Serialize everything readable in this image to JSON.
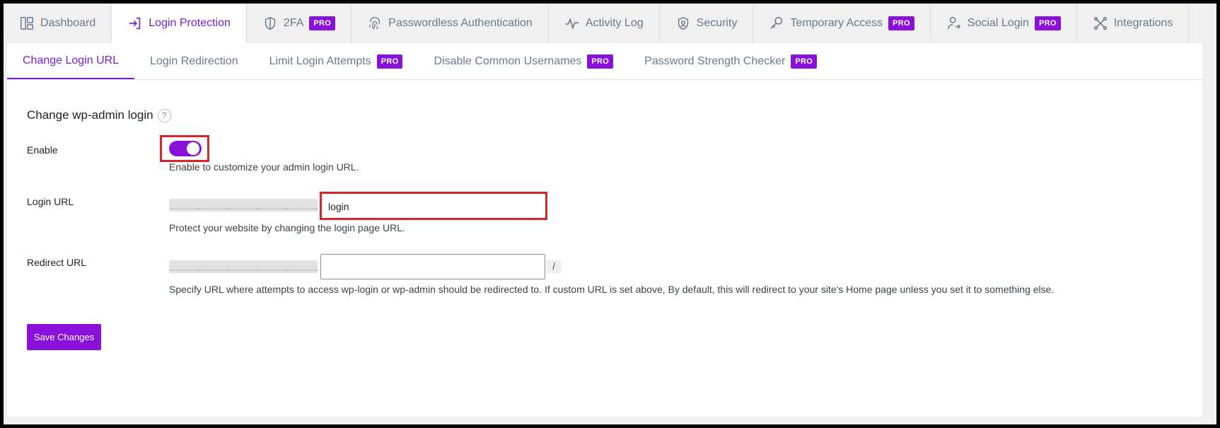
{
  "top_tabs": [
    {
      "label": "Dashboard",
      "icon": "dashboard-icon",
      "pro": false,
      "active": false
    },
    {
      "label": "Login Protection",
      "icon": "login-icon",
      "pro": false,
      "active": true
    },
    {
      "label": "2FA",
      "icon": "shield-icon",
      "pro": true,
      "active": false
    },
    {
      "label": "Passwordless Authentication",
      "icon": "fingerprint-icon",
      "pro": false,
      "active": false
    },
    {
      "label": "Activity Log",
      "icon": "activity-icon",
      "pro": false,
      "active": false
    },
    {
      "label": "Security",
      "icon": "security-shield-icon",
      "pro": false,
      "active": false
    },
    {
      "label": "Temporary Access",
      "icon": "key-icon",
      "pro": true,
      "active": false
    },
    {
      "label": "Social Login",
      "icon": "user-share-icon",
      "pro": true,
      "active": false
    },
    {
      "label": "Integrations",
      "icon": "integrations-icon",
      "pro": false,
      "active": false
    }
  ],
  "pro_badge": "PRO",
  "sub_tabs": [
    {
      "label": "Change Login URL",
      "pro": false,
      "active": true
    },
    {
      "label": "Login Redirection",
      "pro": false,
      "active": false
    },
    {
      "label": "Limit Login Attempts",
      "pro": true,
      "active": false
    },
    {
      "label": "Disable Common Usernames",
      "pro": true,
      "active": false
    },
    {
      "label": "Password Strength Checker",
      "pro": true,
      "active": false
    }
  ],
  "section": {
    "title": "Change wp-admin login",
    "help": "?"
  },
  "enable": {
    "label": "Enable",
    "checked": true,
    "description": "Enable to customize your admin login URL."
  },
  "login_url": {
    "label": "Login URL",
    "value": "login",
    "description": "Protect your website by changing the login page URL."
  },
  "redirect_url": {
    "label": "Redirect URL",
    "value": "",
    "suffix": "/",
    "description": "Specify URL where attempts to access wp-login or wp-admin should be redirected to. If custom URL is set above, By default, this will redirect to your site's Home page unless you set it to something else."
  },
  "save_label": "Save Changes",
  "colors": {
    "accent": "#8a11d9",
    "active_text": "#7a1fd1",
    "highlight_border": "#d4262b"
  }
}
